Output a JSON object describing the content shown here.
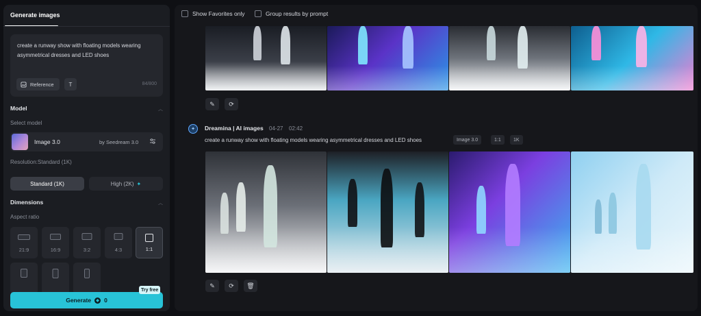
{
  "panel": {
    "tab_label": "Generate images",
    "prompt_text": "create a runway show with floating models wearing asymmetrical dresses and LED shoes",
    "reference_label": "Reference",
    "text_tool_label": "T",
    "char_count": "84/800"
  },
  "model": {
    "section_title": "Model",
    "select_label": "Select model",
    "name": "Image 3.0",
    "by": "by Seedream 3.0",
    "resolution_label": "Resolution:Standard (1K)",
    "standard_label": "Standard (1K)",
    "high_label": "High (2K)"
  },
  "dimensions": {
    "section_title": "Dimensions",
    "aspect_label": "Aspect ratio",
    "ratios": [
      "21:9",
      "16:9",
      "3:2",
      "4:3",
      "1:1"
    ],
    "selected": "1:1"
  },
  "generate": {
    "label": "Generate",
    "credits": "0",
    "badge": "Try free"
  },
  "filters": {
    "favorites": "Show Favorites only",
    "group": "Group results by prompt"
  },
  "generation": {
    "title": "Dreamina | AI images",
    "date": "04-27",
    "time": "02:42",
    "prompt": "create a runway show with floating models wearing asymmetrical dresses and LED shoes",
    "tags": [
      "Image 3.0",
      "1:1",
      "1K"
    ]
  },
  "icons": {
    "reference": "image-reference-icon",
    "edit": "pencil-icon",
    "regenerate": "repeat-icon",
    "delete": "trash-icon",
    "settings": "sliders-icon"
  },
  "colors": {
    "accent": "#28c3d7",
    "panel_bg": "#1b1d22",
    "page_bg": "#0f1014"
  }
}
